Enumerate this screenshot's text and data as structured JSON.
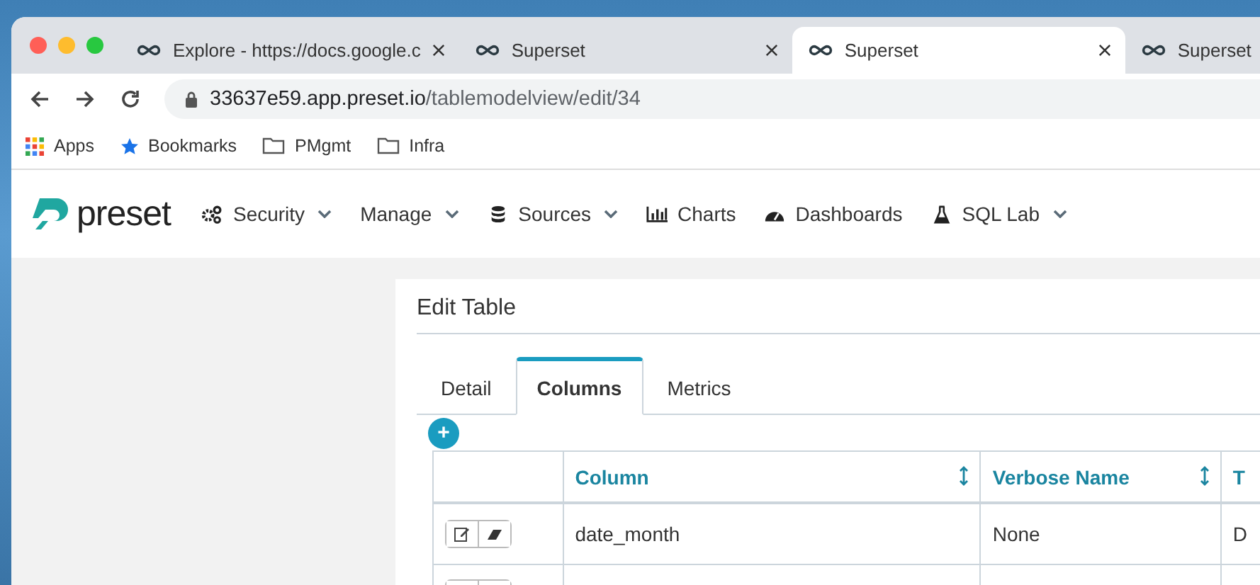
{
  "browser": {
    "tabs": [
      {
        "title": "Explore - https://docs.google.c",
        "selected": false
      },
      {
        "title": "Superset",
        "selected": false
      },
      {
        "title": "Superset",
        "selected": true
      },
      {
        "title": "Superset",
        "selected": false
      }
    ],
    "address": {
      "host": "33637e59.app.preset.io",
      "path": "/tablemodelview/edit/34"
    },
    "bookmarks": [
      {
        "label": "Apps",
        "kind": "apps"
      },
      {
        "label": "Bookmarks",
        "kind": "star"
      },
      {
        "label": "PMgmt",
        "kind": "folder"
      },
      {
        "label": "Infra",
        "kind": "folder"
      }
    ]
  },
  "navbar": {
    "logo": "preset",
    "items": [
      {
        "label": "Security",
        "kind": "gears",
        "dropdown": true
      },
      {
        "label": "Manage",
        "kind": "plain",
        "dropdown": true
      },
      {
        "label": "Sources",
        "kind": "database",
        "dropdown": true
      },
      {
        "label": "Charts",
        "kind": "chart",
        "dropdown": false
      },
      {
        "label": "Dashboards",
        "kind": "gauge",
        "dropdown": false
      },
      {
        "label": "SQL Lab",
        "kind": "flask",
        "dropdown": true
      }
    ]
  },
  "panel": {
    "title": "Edit Table",
    "tabs": [
      {
        "label": "Detail",
        "selected": false
      },
      {
        "label": "Columns",
        "selected": true
      },
      {
        "label": "Metrics",
        "selected": false
      }
    ],
    "add_button": "+",
    "table": {
      "columns": [
        {
          "sortable": false
        },
        {
          "label": "Column",
          "sortable": true
        },
        {
          "label": "Verbose Name",
          "sortable": true
        },
        {
          "label": "T"
        }
      ],
      "rows": [
        {
          "cells": [
            "",
            "date_month",
            "None",
            "D"
          ]
        },
        {
          "cells": [
            "",
            "",
            "",
            ""
          ]
        }
      ]
    }
  }
}
